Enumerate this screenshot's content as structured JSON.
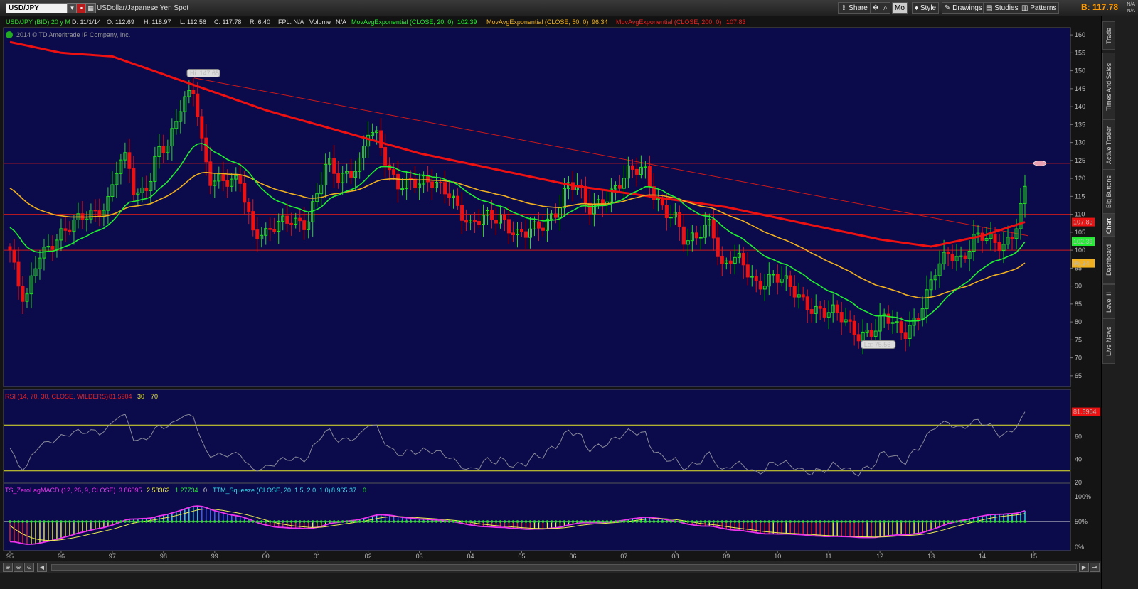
{
  "toolbar": {
    "symbol": "USD/JPY",
    "description": "USDollar/Japanese Yen Spot",
    "share": "Share",
    "style": "Style",
    "drawings": "Drawings",
    "studies": "Studies",
    "patterns": "Patterns",
    "mo": "Mo",
    "bid": "B: 117.78",
    "na_top": "N/A",
    "na_bottom": "N/A"
  },
  "side_tabs": [
    "Trade",
    "Times And Sales",
    "Active Trader",
    "Big Buttons",
    "Chart",
    "Dashboard",
    "Level II",
    "Live News"
  ],
  "side_tab_active": "Chart",
  "colors": {
    "background": "#0b0a4a",
    "up_candle": "#22dd22",
    "down_candle": "#ee1111",
    "ema20": "#22ee33",
    "ema50": "#f0b020",
    "ema200": "#ee1111",
    "rsi_line": "#8a8a9a",
    "rsi_band": "#e8e82a",
    "hist_cyan": "#33ddee",
    "hist_red": "#ee2222",
    "hist_yellow": "#eeee33",
    "macd_line": "#ee33ee",
    "squeeze_dot": "#22ee22"
  },
  "chart_data": [
    {
      "type": "candlestick",
      "header": {
        "symbol_label": "USD/JPY (BID) 20 y M",
        "date": "D: 11/1/14",
        "open": "O: 112.69",
        "high": "H: 118.97",
        "low": "L: 112.56",
        "close": "C: 117.78",
        "range": "R: 6.40",
        "fpl": "FPL: N/A",
        "volume": "Volume",
        "volume_value": "N/A",
        "ema20_label": "MovAvgExponential (CLOSE, 20, 0)",
        "ema20_value": "102.39",
        "ema50_label": "MovAvgExponential (CLOSE, 50, 0)",
        "ema50_value": "96.34",
        "ema200_label": "MovAvgExponential (CLOSE, 200, 0)",
        "ema200_value": "107.83"
      },
      "copyright": "2014 © TD Ameritrade IP Company, Inc.",
      "hi_label": "Hi: 147.65",
      "lo_label": "Lo: 75.56",
      "ylim": [
        62,
        162
      ],
      "y_ticks": [
        65,
        70,
        75,
        80,
        85,
        90,
        95,
        100,
        105,
        110,
        115,
        120,
        125,
        130,
        135,
        140,
        145,
        150,
        155,
        160
      ],
      "x_range": [
        1995.0,
        2015.33
      ],
      "x_ticks": [
        {
          "x": 1995,
          "label": "95"
        },
        {
          "x": 1996,
          "label": "96"
        },
        {
          "x": 1997,
          "label": "97"
        },
        {
          "x": 1998,
          "label": "98"
        },
        {
          "x": 1999,
          "label": "99"
        },
        {
          "x": 2000,
          "label": "00"
        },
        {
          "x": 2001,
          "label": "01"
        },
        {
          "x": 2002,
          "label": "02"
        },
        {
          "x": 2003,
          "label": "03"
        },
        {
          "x": 2004,
          "label": "04"
        },
        {
          "x": 2005,
          "label": "05"
        },
        {
          "x": 2006,
          "label": "06"
        },
        {
          "x": 2007,
          "label": "07"
        },
        {
          "x": 2008,
          "label": "08"
        },
        {
          "x": 2009,
          "label": "09"
        },
        {
          "x": 2010,
          "label": "10"
        },
        {
          "x": 2011,
          "label": "11"
        },
        {
          "x": 2012,
          "label": "12"
        },
        {
          "x": 2013,
          "label": "13"
        },
        {
          "x": 2014,
          "label": "14"
        },
        {
          "x": 2015,
          "label": "15"
        }
      ],
      "close_anchors": [
        [
          1995.0,
          100
        ],
        [
          1995.15,
          90
        ],
        [
          1995.3,
          84
        ],
        [
          1995.55,
          99
        ],
        [
          1995.85,
          103
        ],
        [
          1996.2,
          106
        ],
        [
          1996.5,
          110
        ],
        [
          1996.9,
          113
        ],
        [
          1997.1,
          123
        ],
        [
          1997.3,
          125
        ],
        [
          1997.45,
          114
        ],
        [
          1997.75,
          121
        ],
        [
          1997.9,
          129
        ],
        [
          1998.1,
          128
        ],
        [
          1998.35,
          140
        ],
        [
          1998.6,
          146
        ],
        [
          1998.75,
          131
        ],
        [
          1998.9,
          120
        ],
        [
          1999.0,
          119
        ],
        [
          1999.3,
          118
        ],
        [
          1999.5,
          120
        ],
        [
          1999.75,
          106
        ],
        [
          2000.0,
          104
        ],
        [
          2000.3,
          107
        ],
        [
          2000.5,
          109
        ],
        [
          2000.8,
          108
        ],
        [
          2001.0,
          115
        ],
        [
          2001.2,
          124
        ],
        [
          2001.4,
          120
        ],
        [
          2001.6,
          122
        ],
        [
          2001.85,
          125
        ],
        [
          2002.0,
          133
        ],
        [
          2002.2,
          130
        ],
        [
          2002.4,
          122
        ],
        [
          2002.6,
          119
        ],
        [
          2002.8,
          120
        ],
        [
          2003.0,
          118
        ],
        [
          2003.3,
          118
        ],
        [
          2003.6,
          117
        ],
        [
          2003.8,
          111
        ],
        [
          2004.0,
          106
        ],
        [
          2004.3,
          109
        ],
        [
          2004.6,
          110
        ],
        [
          2004.9,
          104
        ],
        [
          2005.1,
          104
        ],
        [
          2005.4,
          107
        ],
        [
          2005.7,
          112
        ],
        [
          2005.9,
          118
        ],
        [
          2006.1,
          117
        ],
        [
          2006.3,
          111
        ],
        [
          2006.6,
          115
        ],
        [
          2006.9,
          118
        ],
        [
          2007.1,
          121
        ],
        [
          2007.4,
          123
        ],
        [
          2007.6,
          116
        ],
        [
          2007.8,
          111
        ],
        [
          2008.0,
          108
        ],
        [
          2008.2,
          101
        ],
        [
          2008.5,
          106
        ],
        [
          2008.7,
          109
        ],
        [
          2008.9,
          94
        ],
        [
          2009.1,
          97
        ],
        [
          2009.3,
          97
        ],
        [
          2009.6,
          91
        ],
        [
          2009.9,
          92
        ],
        [
          2010.1,
          91
        ],
        [
          2010.4,
          88
        ],
        [
          2010.7,
          84
        ],
        [
          2010.9,
          82
        ],
        [
          2011.1,
          82
        ],
        [
          2011.3,
          81
        ],
        [
          2011.6,
          77
        ],
        [
          2011.9,
          77
        ],
        [
          2012.1,
          81
        ],
        [
          2012.3,
          79
        ],
        [
          2012.5,
          78
        ],
        [
          2012.75,
          82
        ],
        [
          2012.9,
          86
        ],
        [
          2013.1,
          94
        ],
        [
          2013.35,
          100
        ],
        [
          2013.6,
          98
        ],
        [
          2013.85,
          103
        ],
        [
          2014.0,
          103
        ],
        [
          2014.2,
          102
        ],
        [
          2014.4,
          102
        ],
        [
          2014.55,
          104
        ],
        [
          2014.7,
          109
        ],
        [
          2014.85,
          117.78
        ]
      ],
      "annotations": {
        "hi": {
          "x": 1998.6,
          "y": 147.65
        },
        "lo": {
          "x": 2011.8,
          "y": 75.56
        },
        "trendline": {
          "x1": 1998.6,
          "y1": 148,
          "x2": 2014.9,
          "y2": 104
        },
        "hlines": [
          124.2,
          110,
          100
        ]
      },
      "last_values": {
        "ema200": "107.83",
        "ema20": "102.39",
        "ema50": "96.34"
      }
    },
    {
      "type": "line",
      "label": "RSI (14, 70, 30, CLOSE, WILDERS)",
      "value": "81.5904",
      "level_low": "30",
      "level_high": "70",
      "ylim": [
        15,
        90
      ],
      "y_ticks": [
        20,
        40,
        60
      ],
      "bands": [
        30,
        70
      ]
    },
    {
      "type": "bar",
      "macd_label": "TS_ZeroLagMACD (12, 26, 9, CLOSE)",
      "macd_values": [
        "3.86095",
        "2.58362",
        "1.27734",
        "0"
      ],
      "squeeze_label": "TTM_Squeeze (CLOSE, 20, 1.5, 2.0, 1.0)",
      "squeeze_values": [
        "8,965.37",
        "0"
      ],
      "y_ticks": [
        "100%",
        "50%",
        "0%"
      ]
    }
  ]
}
